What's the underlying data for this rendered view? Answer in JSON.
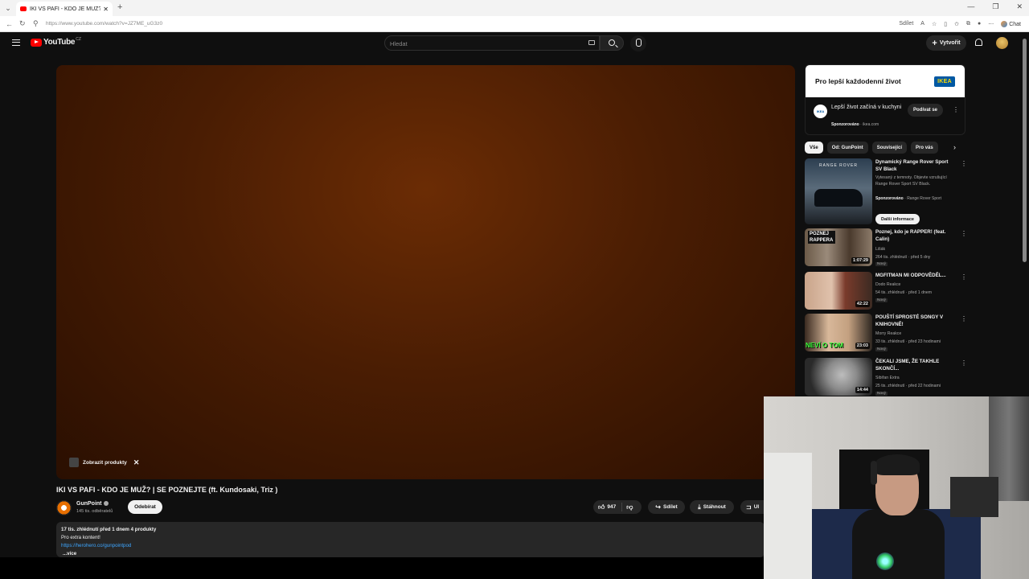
{
  "browser": {
    "tab_title": "IKI VS PAFI - KDO JE MUŽ? | SE PO",
    "url": "https://www.youtube.com/watch?v=JZ7ME_uG3z0",
    "share_label": "Sdílet",
    "chat_label": "Chat"
  },
  "header": {
    "logo_text": "YouTube",
    "logo_country": "CZ",
    "search_placeholder": "Hledat",
    "create_label": "Vytvořit"
  },
  "player": {
    "products_chip": "Zobrazit produkty"
  },
  "video": {
    "title": "IKI VS PAFI - KDO JE MUŽ? | SE POZNEJTE (ft. Kundosaki, Triz )",
    "channel": "GunPoint",
    "subscribers": "145 tis. odběratelů",
    "subscribe_label": "Odebírat",
    "likes": "947",
    "share_label": "Sdílet",
    "download_label": "Stáhnout",
    "save_label": "Ul",
    "desc_meta": "17 tis. zhlédnutí  před 1 dnem  4 produkty",
    "desc_line": "Pro extra kontent!",
    "desc_link": "https://herohero.co/gunpointpod",
    "desc_more": "...více"
  },
  "ad": {
    "banner_text": "Pro lepší každodenní život",
    "brand": "IKEA",
    "title": "Lepší život začíná v kuchyni",
    "sponsored": "Sponzorováno",
    "domain": "ikea.com",
    "watch_label": "Podívat se"
  },
  "chips": [
    "Vše",
    "Od: GunPoint",
    "Související",
    "Pro vás"
  ],
  "recommendations": [
    {
      "title": "Dynamický Range Rover Sport SV Black",
      "desc": "Vytesaný z temnoty. Objevte vzrušující Range Rover Sport SV Black.",
      "sponsored": "Sponzorováno",
      "advertiser": "Range Rover Sport",
      "more_label": "Další informace",
      "thumb_text": "RANGE ROVER"
    },
    {
      "title": "Poznej, kdo je RAPPER! (feat. Calin)",
      "channel": "Lišák",
      "stats": "264 tis. zhlédnutí · před 5 dny",
      "badge": "Nový",
      "duration": "1:07:29",
      "thumb_text": "POZNEJ RAPPERA"
    },
    {
      "title": "MGFITMAN MI ODPOVĚDĚL...",
      "channel": "Dodo Reakce",
      "stats": "54 tis. zhlédnutí · před 1 dnem",
      "badge": "Nový",
      "duration": "42:22"
    },
    {
      "title": "POUŠTÍ SPROSTÉ SONGY V KNIHOVNĚ!",
      "channel": "Morry Reakce",
      "stats": "33 tis. zhlédnutí · před 23 hodinami",
      "badge": "Nový",
      "duration": "23:03",
      "thumb_text": "NEVÍ O TOM"
    },
    {
      "title": "ČEKALI JSME, ŽE TAKHLE SKONČÍ...",
      "channel": "Sibiřan Extra",
      "stats": "25 tis. zhlédnutí · před 22 hodinami",
      "badge": "Nový",
      "duration": "14:44"
    }
  ],
  "colors": {
    "accent_red": "#ff0000",
    "link_blue": "#3ea6ff",
    "background": "#0f0f0f"
  }
}
